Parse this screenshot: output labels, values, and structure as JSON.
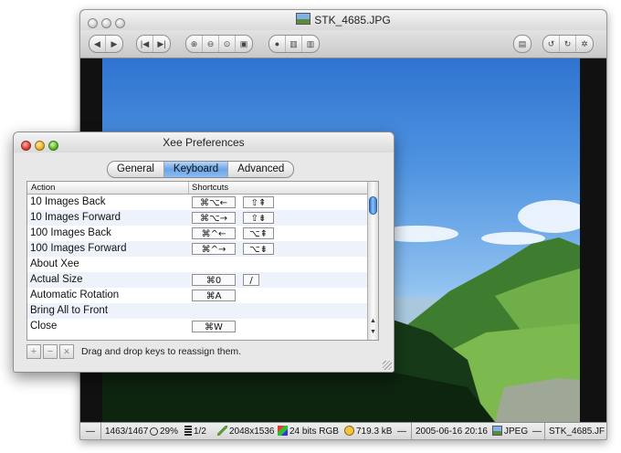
{
  "viewer": {
    "title": "STK_4685.JPG",
    "status": {
      "index": "1463/1467",
      "zoom": "29%",
      "page": "1/2",
      "dimensions": "2048x1536",
      "color": "24 bits RGB",
      "size": "719.3 kB",
      "date": "2005-06-16 20:16",
      "format": "JPEG",
      "filename": "STK_4685.JF"
    }
  },
  "prefs": {
    "title": "Xee Preferences",
    "tabs": [
      {
        "label": "General",
        "active": false
      },
      {
        "label": "Keyboard",
        "active": true
      },
      {
        "label": "Advanced",
        "active": false
      }
    ],
    "columns": {
      "action": "Action",
      "shortcuts": "Shortcuts"
    },
    "rows": [
      {
        "action": "10 Images Back",
        "key1": "⌘⌥←",
        "key2": "⇧⇞"
      },
      {
        "action": "10 Images Forward",
        "key1": "⌘⌥→",
        "key2": "⇧⇟"
      },
      {
        "action": "100 Images Back",
        "key1": "⌘^←",
        "key2": "⌥⇞"
      },
      {
        "action": "100 Images Forward",
        "key1": "⌘^→",
        "key2": "⌥⇟"
      },
      {
        "action": "About Xee",
        "key1": "",
        "key2": ""
      },
      {
        "action": "Actual Size",
        "key1": "⌘0",
        "key2": "/"
      },
      {
        "action": "Automatic Rotation",
        "key1": "⌘A",
        "key2": ""
      },
      {
        "action": "Bring All to Front",
        "key1": "",
        "key2": ""
      },
      {
        "action": "Close",
        "key1": "⌘W",
        "key2": ""
      }
    ],
    "bottom": {
      "add": "+",
      "remove": "−",
      "clear": "✕",
      "hint": "Drag and drop keys to reassign them."
    }
  }
}
